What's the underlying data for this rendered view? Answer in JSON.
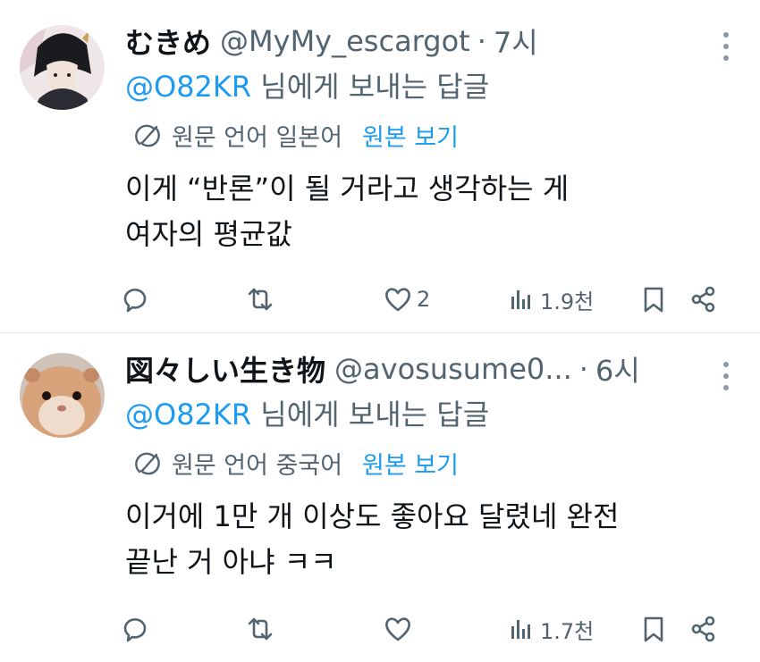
{
  "tweets": [
    {
      "author_name": "むきめ",
      "handle": "@MyMy_escargot",
      "separator": "·",
      "time": "7시",
      "reply_mention": "@O82KR",
      "reply_suffix": " 님에게 보내는 답글",
      "translate_label": "원문 언어 일본어",
      "view_original": "원본 보기",
      "body_lines": [
        "이게 “반론”이 될 거라고 생각하는 게",
        "여자의 평균값"
      ],
      "likes": "2",
      "views": "1.9천"
    },
    {
      "author_name": "図々しい生き物",
      "handle": "@avosusume0...",
      "separator": "·",
      "time": "6시",
      "reply_mention": "@O82KR",
      "reply_suffix": " 님에게 보내는 답글",
      "translate_label": "원문 언어 중국어",
      "view_original": "원본 보기",
      "body_lines": [
        "이거에 1만 개 이상도 좋아요 달렸네 완전",
        "끝난 거 아냐 ㅋㅋ"
      ],
      "likes": "",
      "views": "1.7천"
    }
  ],
  "colors": {
    "accent": "#1d9bf0",
    "muted": "#536471",
    "text": "#0f1419"
  }
}
